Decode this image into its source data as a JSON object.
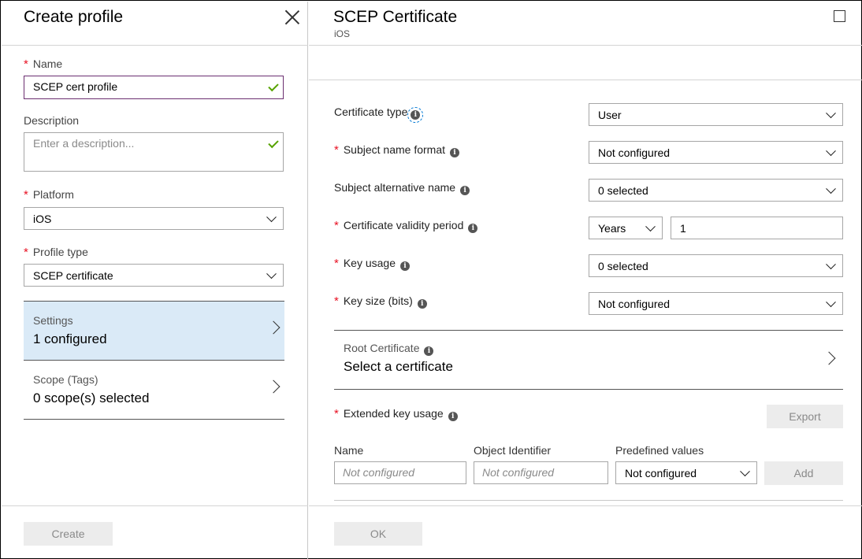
{
  "left_blade": {
    "title": "Create profile",
    "name": {
      "label": "Name",
      "value": "SCEP cert profile"
    },
    "description": {
      "label": "Description",
      "placeholder": "Enter a description..."
    },
    "platform": {
      "label": "Platform",
      "value": "iOS"
    },
    "profile_type": {
      "label": "Profile type",
      "value": "SCEP certificate"
    },
    "nav": [
      {
        "label": "Settings",
        "value": "1 configured"
      },
      {
        "label": "Scope (Tags)",
        "value": "0 scope(s) selected"
      }
    ],
    "create_label": "Create"
  },
  "right_blade": {
    "title": "SCEP Certificate",
    "subtitle": "iOS",
    "rows": {
      "certificate_type": {
        "label": "Certificate type",
        "value": "User"
      },
      "subject_name_format": {
        "label": "Subject name format",
        "value": "Not configured"
      },
      "subject_alt_name": {
        "label": "Subject alternative name",
        "value": "0 selected"
      },
      "validity_period": {
        "label": "Certificate validity period",
        "unit": "Years",
        "value": "1"
      },
      "key_usage": {
        "label": "Key usage",
        "value": "0 selected"
      },
      "key_size": {
        "label": "Key size (bits)",
        "value": "Not configured"
      }
    },
    "root_certificate": {
      "label": "Root Certificate",
      "value": "Select a certificate"
    },
    "extended_key_usage": {
      "label": "Extended key usage",
      "export_label": "Export",
      "columns": [
        "Name",
        "Object Identifier",
        "Predefined values"
      ],
      "name_placeholder": "Not configured",
      "oid_placeholder": "Not configured",
      "predefined_value": "Not configured",
      "add_label": "Add"
    },
    "ok_label": "OK"
  },
  "colors": {
    "required": "#e81123",
    "selected_nav": "#daeaf7",
    "check": "#57a300",
    "focus_border": "#6b2e70"
  }
}
